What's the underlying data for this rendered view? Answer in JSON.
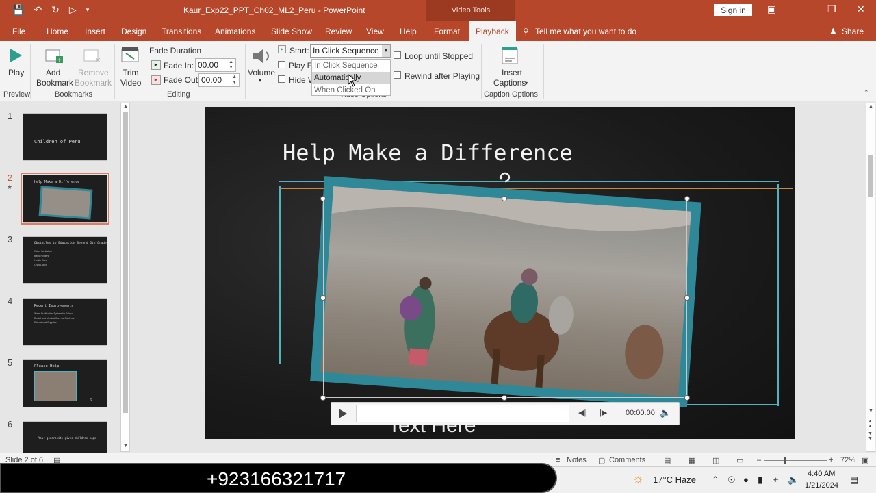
{
  "window": {
    "title": "Kaur_Exp22_PPT_Ch02_ML2_Peru - PowerPoint",
    "context_label": "Video Tools",
    "signin": "Sign in"
  },
  "tabs": [
    "File",
    "Home",
    "Insert",
    "Design",
    "Transitions",
    "Animations",
    "Slide Show",
    "Review",
    "View",
    "Help",
    "Format",
    "Playback"
  ],
  "tell_me": "Tell me what you want to do",
  "share": "Share",
  "ribbon": {
    "preview": {
      "play": "Play",
      "group": "Preview"
    },
    "bookmarks": {
      "add": "Add",
      "add2": "Bookmark",
      "remove": "Remove",
      "remove2": "Bookmark",
      "group": "Bookmarks"
    },
    "editing": {
      "trim": "Trim",
      "trim2": "Video",
      "fade_duration": "Fade Duration",
      "fade_in_label": "Fade In:",
      "fade_in_value": "00.00",
      "fade_out_label": "Fade Out:",
      "fade_out_value": "00.00",
      "group": "Editing"
    },
    "video_options": {
      "volume": "Volume",
      "start_label": "Start:",
      "start_value": "In Click Sequence",
      "play_full": "Play Fu",
      "hide": "Hide W",
      "loop": "Loop until Stopped",
      "rewind": "Rewind after Playing",
      "group": "Video Options",
      "dropdown": [
        "In Click Sequence",
        "Automatically",
        "When Clicked On"
      ]
    },
    "captions": {
      "insert": "Insert",
      "insert2": "Captions",
      "group": "Caption Options"
    }
  },
  "thumbnails": [
    {
      "num": "1",
      "title": "Children of Peru",
      "bullets": []
    },
    {
      "num": "2",
      "title": "Help Make a Difference",
      "bullets": []
    },
    {
      "num": "3",
      "title": "Obstacles to Education Beyond 6th Grade",
      "bullets": [
        "Water Sanitation",
        "Basic Hygiene",
        "Health Care",
        "Child Labor"
      ]
    },
    {
      "num": "4",
      "title": "Recent Improvements",
      "bullets": [
        "Water Purification System for School",
        "Dental and Medical Care for Students",
        "Educational Supplies"
      ]
    },
    {
      "num": "5",
      "title": "Please Help",
      "bullets": []
    },
    {
      "num": "6",
      "title": "Your generosity gives children hope",
      "bullets": []
    }
  ],
  "slide": {
    "title": "Help Make a Difference",
    "placeholder": "Text Here",
    "media_time": "00:00.00"
  },
  "status": {
    "slide_of": "Slide 2 of 6",
    "notes": "Notes",
    "comments": "Comments",
    "zoom": "72%"
  },
  "taskbar": {
    "phone": "+923166321717",
    "weather": "17°C  Haze",
    "time": "4:40 AM",
    "date": "1/21/2024"
  },
  "colors": {
    "accent": "#b7472a",
    "slide_teal": "#2f8898"
  }
}
